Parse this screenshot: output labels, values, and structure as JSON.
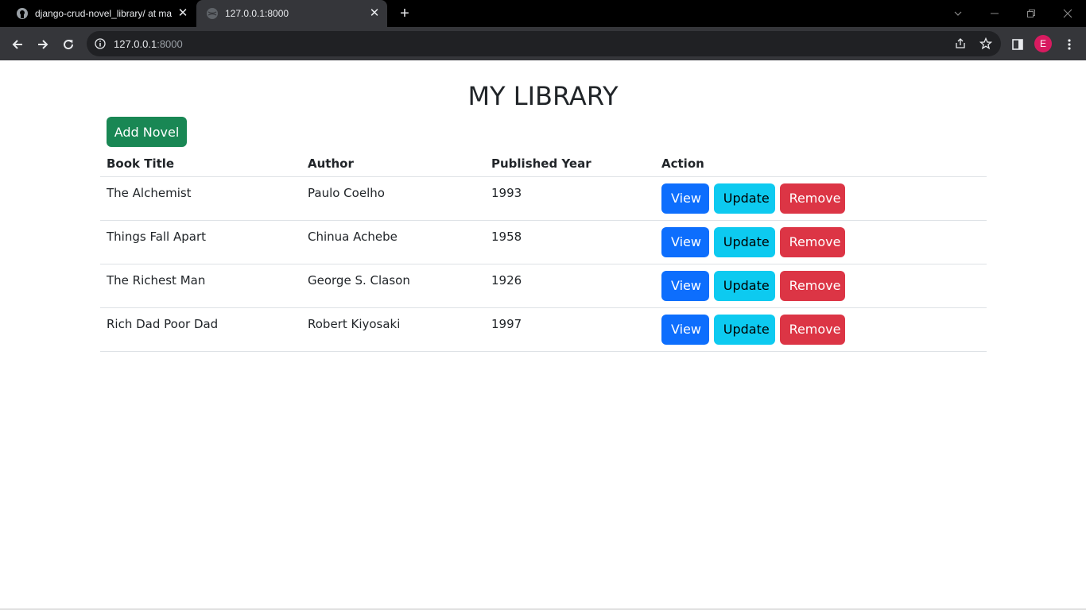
{
  "browser": {
    "tabs": [
      {
        "title": "django-crud-novel_library/ at ma",
        "icon": "github-icon",
        "active": false
      },
      {
        "title": "127.0.0.1:8000",
        "icon": "globe-icon",
        "active": true
      }
    ],
    "address": {
      "host": "127.0.0.1",
      "port": ":8000"
    },
    "profile_initial": "E"
  },
  "page": {
    "title": "MY LIBRARY",
    "add_button": "Add Novel",
    "columns": [
      "Book Title",
      "Author",
      "Published Year",
      "Action"
    ],
    "actions": {
      "view": "View",
      "update": "Update",
      "remove": "Remove"
    },
    "rows": [
      {
        "title": "The Alchemist",
        "author": "Paulo Coelho",
        "year": "1993"
      },
      {
        "title": "Things Fall Apart",
        "author": "Chinua Achebe",
        "year": "1958"
      },
      {
        "title": "The Richest Man",
        "author": "George S. Clason",
        "year": "1926"
      },
      {
        "title": "Rich Dad Poor Dad",
        "author": "Robert Kiyosaki",
        "year": "1997"
      }
    ]
  },
  "colors": {
    "add": "#198754",
    "view": "#0d6efd",
    "update": "#0dcaf0",
    "remove": "#dc3545"
  }
}
